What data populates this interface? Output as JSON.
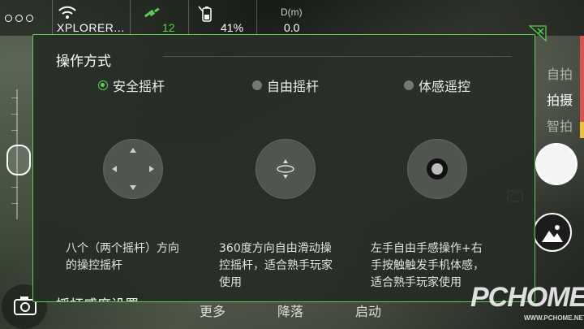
{
  "topbar": {
    "device_name": "XPLORER...",
    "gps_count": "12",
    "battery": "41%",
    "distance_label": "D(m)",
    "distance_value": "0.0"
  },
  "right_column": {
    "modes": [
      "自拍",
      "拍摄",
      "智拍"
    ],
    "active_mode": "拍摄"
  },
  "panel": {
    "title": "操作方式",
    "options": [
      {
        "label": "安全摇杆",
        "selected": true
      },
      {
        "label": "自由摇杆",
        "selected": false
      },
      {
        "label": "体感遥控",
        "selected": false
      }
    ],
    "descriptions": [
      [
        "八个（两个摇杆）方向",
        "的操控摇杆"
      ],
      [
        "360度方向自由滑动操",
        "控摇杆，适合熟手玩家",
        "使用"
      ],
      [
        "左手自由手感操作+右",
        "手按触触发手机体感，",
        "适合熟手玩家使用"
      ]
    ],
    "next_section": "摇杆感度设置"
  },
  "bottom_toolbar": [
    "更多",
    "降落",
    "启动"
  ],
  "watermark": {
    "brand": "PCHOME",
    "sub": "WWW.PCHOME.NET"
  },
  "colors": {
    "accent": "#58d14b",
    "panel_bg": "#262c26",
    "gps_green": "#58d14b"
  }
}
